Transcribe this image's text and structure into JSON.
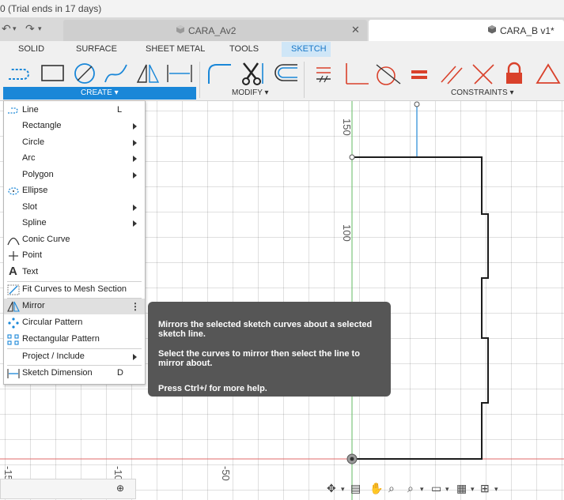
{
  "window": {
    "title_fragment": "0 (Trial ends in 17 days)"
  },
  "tabs": [
    {
      "label": "CARA_Av2",
      "active": false
    },
    {
      "label": "CARA_B v1*",
      "active": true
    }
  ],
  "workspace_tabs": [
    "SOLID",
    "SURFACE",
    "SHEET METAL",
    "TOOLS",
    "SKETCH"
  ],
  "active_workspace": "SKETCH",
  "toolbar": {
    "groups": {
      "create": "CREATE ▾",
      "modify": "MODIFY ▾",
      "constraints": "CONSTRAINTS ▾"
    },
    "create_icons": [
      "line-icon",
      "rectangle-icon",
      "circle-icon",
      "spline-icon",
      "mirror-icon",
      "dimension-icon"
    ],
    "modify_icons": [
      "fillet-icon",
      "trim-icon",
      "offset-icon"
    ],
    "constraint_icons": [
      "coincident-icon",
      "perpendicular-icon",
      "tangent-icon",
      "equal-icon",
      "parallel-icon",
      "collinear-icon",
      "fix-icon",
      "triangle-icon"
    ]
  },
  "create_menu": {
    "items": [
      {
        "label": "Line",
        "shortcut": "L",
        "submenu": false,
        "icon": "line-icon"
      },
      {
        "label": "Rectangle",
        "shortcut": "",
        "submenu": true,
        "icon": ""
      },
      {
        "label": "Circle",
        "shortcut": "",
        "submenu": true,
        "icon": ""
      },
      {
        "label": "Arc",
        "shortcut": "",
        "submenu": true,
        "icon": ""
      },
      {
        "label": "Polygon",
        "shortcut": "",
        "submenu": true,
        "icon": ""
      },
      {
        "label": "Ellipse",
        "shortcut": "",
        "submenu": false,
        "icon": "ellipse-icon"
      },
      {
        "label": "Slot",
        "shortcut": "",
        "submenu": true,
        "icon": ""
      },
      {
        "label": "Spline",
        "shortcut": "",
        "submenu": true,
        "icon": ""
      },
      {
        "label": "Conic Curve",
        "shortcut": "",
        "submenu": false,
        "icon": "conic-curve-icon"
      },
      {
        "label": "Point",
        "shortcut": "",
        "submenu": false,
        "icon": "point-icon"
      },
      {
        "label": "Text",
        "shortcut": "",
        "submenu": false,
        "icon": "text-icon"
      },
      {
        "label": "Fit Curves to Mesh Section",
        "shortcut": "",
        "submenu": false,
        "icon": "fit-curves-icon"
      },
      {
        "label": "Mirror",
        "shortcut": "",
        "submenu": false,
        "icon": "mirror-icon",
        "highlighted": true
      },
      {
        "label": "Circular Pattern",
        "shortcut": "",
        "submenu": false,
        "icon": "circular-pattern-icon"
      },
      {
        "label": "Rectangular Pattern",
        "shortcut": "",
        "submenu": false,
        "icon": "rectangular-pattern-icon"
      },
      {
        "label": "Project / Include",
        "shortcut": "",
        "submenu": true,
        "icon": ""
      },
      {
        "label": "Sketch Dimension",
        "shortcut": "D",
        "submenu": false,
        "icon": "sketch-dimension-icon"
      }
    ]
  },
  "tooltip": {
    "line1": "Mirrors the selected sketch curves about a selected sketch line.",
    "line2": "Select the curves to mirror then select the line to mirror about.",
    "line3": "Press Ctrl+/ for more help."
  },
  "canvas": {
    "vertical_ruler_labels": [
      "150",
      "100"
    ],
    "horizontal_ruler_labels": [
      "-15",
      "-10",
      "-50"
    ]
  },
  "colors": {
    "accent": "#1a87d8",
    "sketch_line": "#1c1c1c",
    "selected_line": "#5aa6e0",
    "axis_green": "#7bc67b",
    "axis_red": "#e06a6a",
    "tooltip_bg": "#565656"
  },
  "navbar_icons": [
    "orbit-icon",
    "look-at-icon",
    "pan-icon",
    "zoom-icon",
    "fit-icon",
    "display-icon",
    "grid-icon",
    "viewports-icon"
  ]
}
